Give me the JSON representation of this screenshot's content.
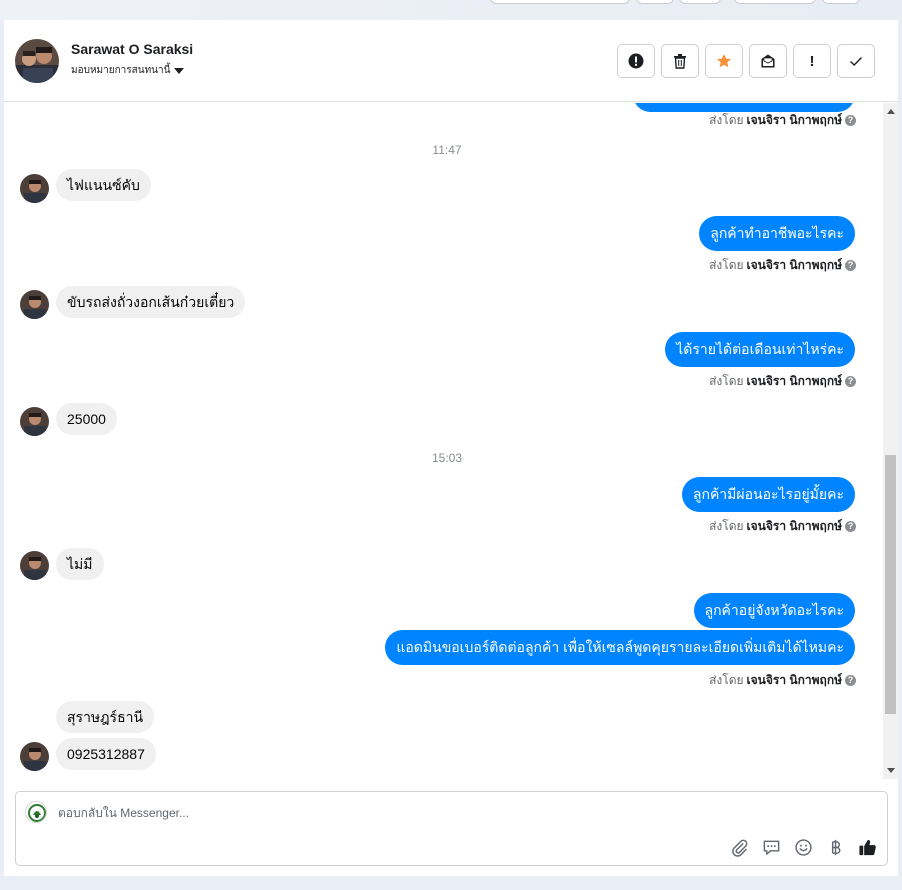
{
  "header": {
    "contact_name": "Sarawat O Saraksi",
    "assign_label": "มอบหมายการสนทนานี้"
  },
  "actions": [
    {
      "name": "spam-icon"
    },
    {
      "name": "trash-icon"
    },
    {
      "name": "star-icon",
      "color": "#f7923b"
    },
    {
      "name": "mark-unread-icon"
    },
    {
      "name": "follow-up-icon",
      "glyph": "!"
    },
    {
      "name": "check-icon"
    }
  ],
  "messages": {
    "sent_by_prefix": "ส่งโดย",
    "sent_by_name": "เจนจิรา นิกาพฤกษ์",
    "timestamp_1": "11:47",
    "timestamp_2": "15:03",
    "in_1": "ไฟแนนซ์คับ",
    "out_1": "ลูกค้าทำอาชีพอะไรคะ",
    "in_2": "ขับรถส่งถั่วงอกเส้นก๋วยเตี๋ยว",
    "out_2": "ได้รายได้ต่อเดือนเท่าไหร่คะ",
    "in_3": "25000",
    "out_3": "ลูกค้ามีผ่อนอะไรอยู่มั้ยคะ",
    "in_4": "ไม่มี",
    "out_4": "ลูกค้าอยู่จังหวัดอะไรคะ",
    "out_5": "แอดมินขอเบอร์ติดต่อลูกค้า เพื่อให้เซลล์พูดคุยรายละเอียดเพิ่มเติมได้ไหมคะ",
    "in_5": "สุราษฎร์ธานี",
    "in_6": "0925312887"
  },
  "composer": {
    "placeholder": "ตอบกลับใน Messenger..."
  },
  "colors": {
    "accent": "#0084ff",
    "incoming_bubble": "#f0f0f0"
  }
}
